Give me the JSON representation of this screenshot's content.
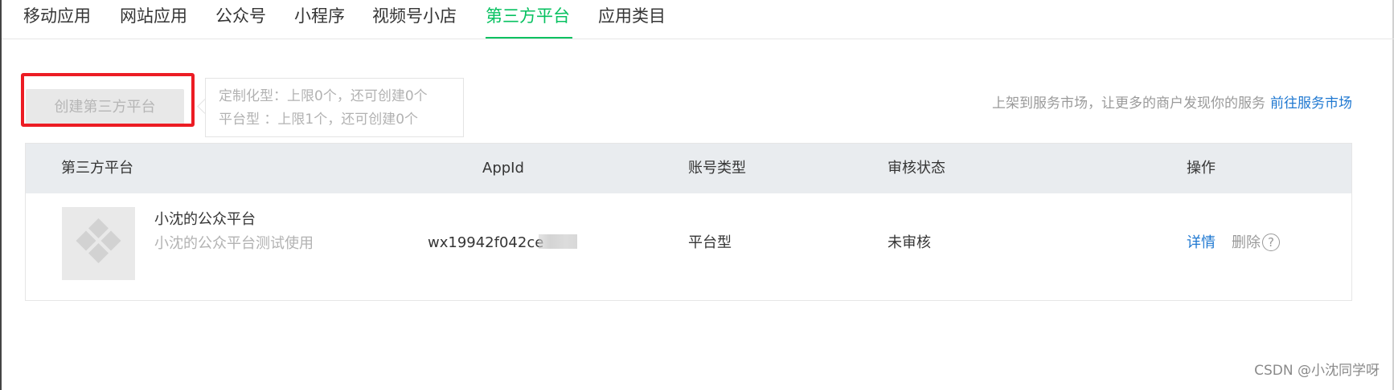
{
  "tabs": [
    {
      "label": "移动应用",
      "active": false
    },
    {
      "label": "网站应用",
      "active": false
    },
    {
      "label": "公众号",
      "active": false
    },
    {
      "label": "小程序",
      "active": false
    },
    {
      "label": "视频号小店",
      "active": false
    },
    {
      "label": "第三方平台",
      "active": true
    },
    {
      "label": "应用类目",
      "active": false
    }
  ],
  "create": {
    "button_label": "创建第三方平台",
    "button_disabled": true,
    "tooltip_line1": "定制化型：上限0个，还可创建0个",
    "tooltip_line2": "平台型 ：上限1个，还可创建0个"
  },
  "market": {
    "text": "上架到服务市场，让更多的商户发现你的服务",
    "link_label": "前往服务市场"
  },
  "table": {
    "columns": [
      "第三方平台",
      "AppId",
      "账号类型",
      "审核状态",
      "操作"
    ],
    "rows": [
      {
        "name": "小沈的公众平台",
        "desc": "小沈的公众平台测试使用",
        "appid": "wx19942f042ce",
        "account_type": "平台型",
        "review_status": "未审核",
        "detail_label": "详情",
        "delete_label": "删除",
        "help_icon": "?"
      }
    ]
  },
  "watermark": "CSDN @小沈同学呀",
  "colors": {
    "accent_green": "#07c160",
    "link_blue": "#1f78d1",
    "highlight_red": "#ec1c24"
  },
  "icons": {
    "thumbnail": "diamond-grid-placeholder-icon",
    "help": "question-circle-icon"
  }
}
